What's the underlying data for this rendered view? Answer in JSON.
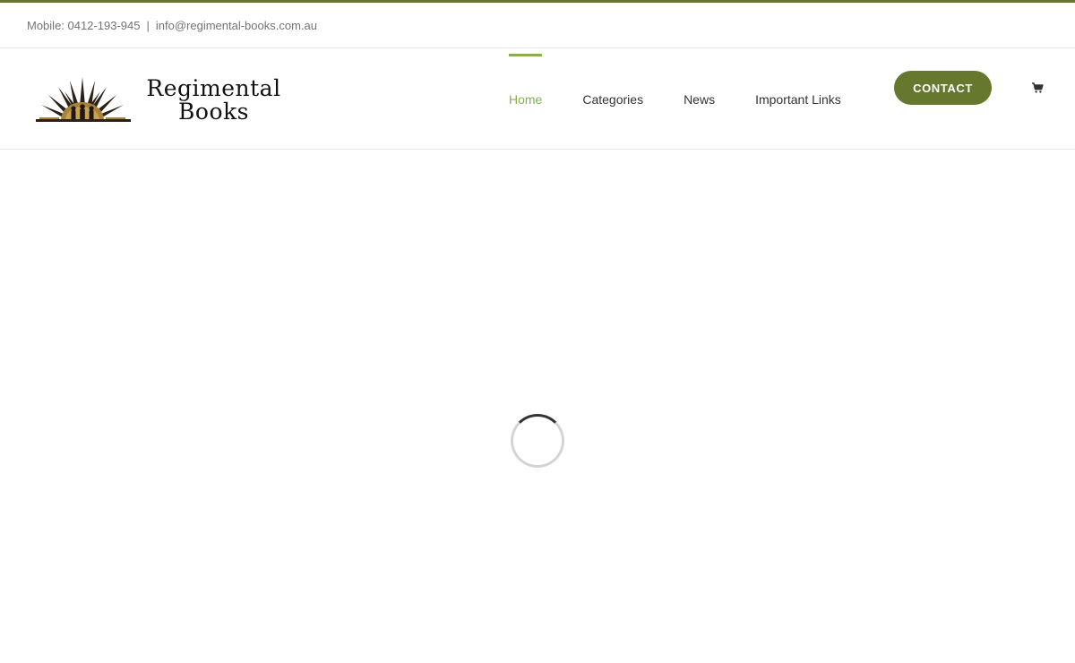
{
  "topbar": {
    "mobile": "Mobile: 0412-193-945",
    "separator": "|",
    "email": "info@regimental-books.com.au"
  },
  "logo": {
    "line1": "Regimental",
    "line2": "Books"
  },
  "nav": {
    "items": [
      {
        "label": "Home",
        "active": true
      },
      {
        "label": "Categories",
        "active": false
      },
      {
        "label": "News",
        "active": false
      },
      {
        "label": "Important Links",
        "active": false
      }
    ],
    "contact_label": "CONTACT",
    "cart_icon": "shopping-cart-icon"
  },
  "colors": {
    "brand_green": "#65782e",
    "active_green": "#8ab04e",
    "text_gray": "#747474"
  },
  "loading": {
    "spinner_icon": "loading-spinner-icon"
  }
}
